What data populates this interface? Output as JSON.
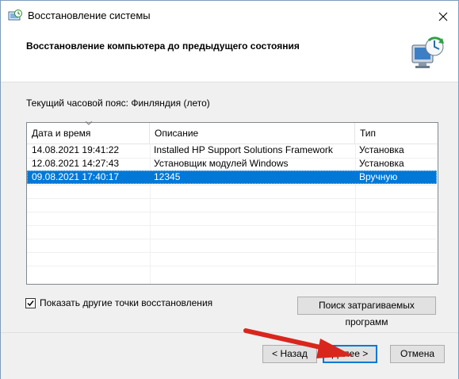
{
  "window": {
    "title": "Восстановление системы",
    "header": "Восстановление компьютера до предыдущего состояния"
  },
  "timezone_label": "Текущий часовой пояс: Финляндия (лето)",
  "list": {
    "columns": [
      "Дата и время",
      "Описание",
      "Тип"
    ],
    "rows": [
      {
        "date": "14.08.2021 19:41:22",
        "description": "Installed HP Support Solutions Framework",
        "type": "Установка",
        "selected": false
      },
      {
        "date": "12.08.2021 14:27:43",
        "description": "Установщик модулей Windows",
        "type": "Установка",
        "selected": false
      },
      {
        "date": "09.08.2021 17:40:17",
        "description": "12345",
        "type": "Вручную",
        "selected": true
      }
    ]
  },
  "show_more_checkbox": {
    "label": "Показать другие точки восстановления",
    "checked": true
  },
  "buttons": {
    "scan": "Поиск затрагиваемых программ",
    "back": "< Назад",
    "next": "Далее >",
    "cancel": "Отмена"
  },
  "colors": {
    "selection": "#0078d7",
    "annotation_arrow": "#d9261c"
  }
}
